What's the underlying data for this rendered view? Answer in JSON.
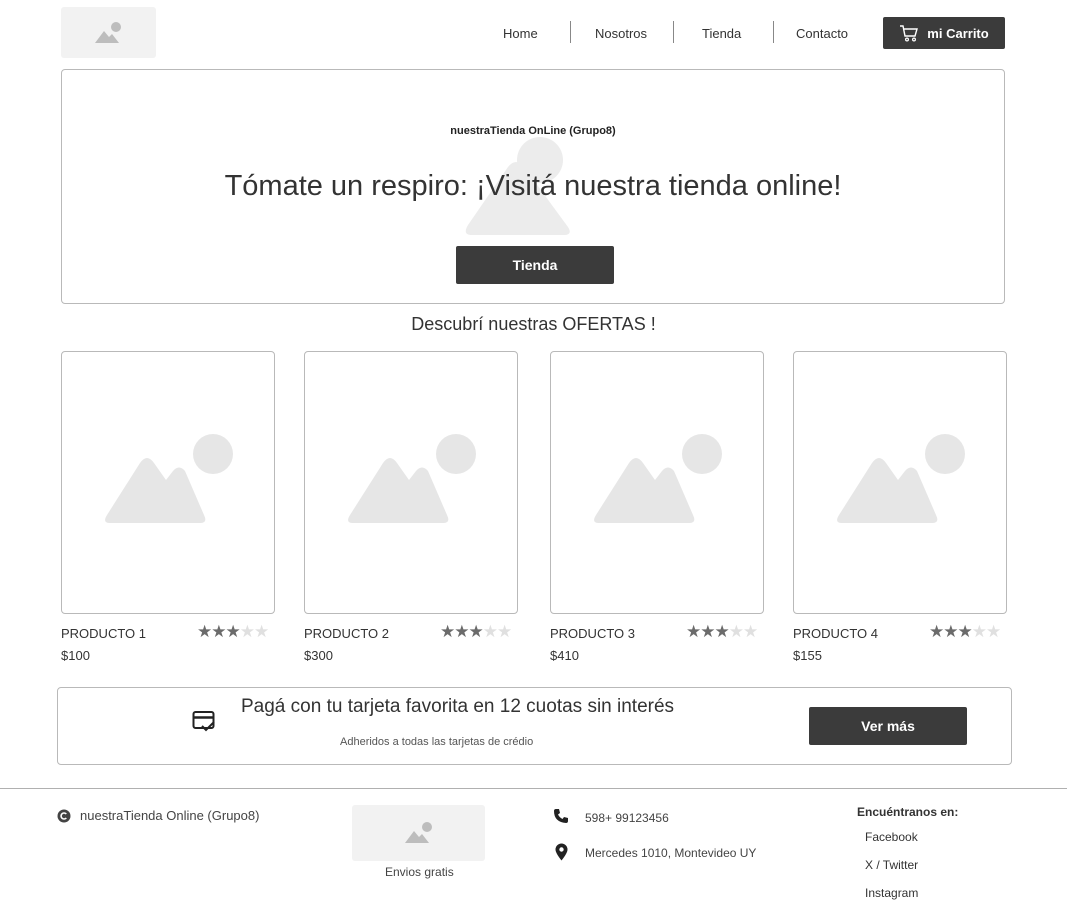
{
  "nav": {
    "links": [
      "Home",
      "Nosotros",
      "Tienda",
      "Contacto"
    ],
    "cart_label": "mi Carrito"
  },
  "hero": {
    "kicker": "nuestraTienda OnLine (Grupo8)",
    "title": "Tómate un respiro: ¡Visitá nuestra tienda online!",
    "button_label": "Tienda"
  },
  "offers": {
    "title": "Descubrí nuestras OFERTAS !",
    "products": [
      {
        "name": "PRODUCTO 1",
        "price": "$100",
        "rating": 3,
        "max_rating": 5
      },
      {
        "name": "PRODUCTO 2",
        "price": "$300",
        "rating": 3,
        "max_rating": 5
      },
      {
        "name": "PRODUCTO 3",
        "price": "$410",
        "rating": 3,
        "max_rating": 5
      },
      {
        "name": "PRODUCTO 4",
        "price": "$155",
        "rating": 3,
        "max_rating": 5
      }
    ]
  },
  "promo": {
    "title": "Pagá con tu tarjeta favorita en 12 cuotas sin interés",
    "subtitle": "Adheridos a todas las tarjetas de crédio",
    "button_label": "Ver más"
  },
  "footer": {
    "copyright": "nuestraTienda Online (Grupo8)",
    "shipping_label": "Envios gratis",
    "phone": "598+ 99123456",
    "address": "Mercedes 1010, Montevideo UY",
    "social_title": "Encuéntranos en:",
    "social_links": [
      "Facebook",
      "X / Twitter",
      "Instagram"
    ]
  },
  "colors": {
    "dark_button": "#3b3b3b",
    "border": "#b9b9b9",
    "placeholder": "#e6e6e6"
  }
}
